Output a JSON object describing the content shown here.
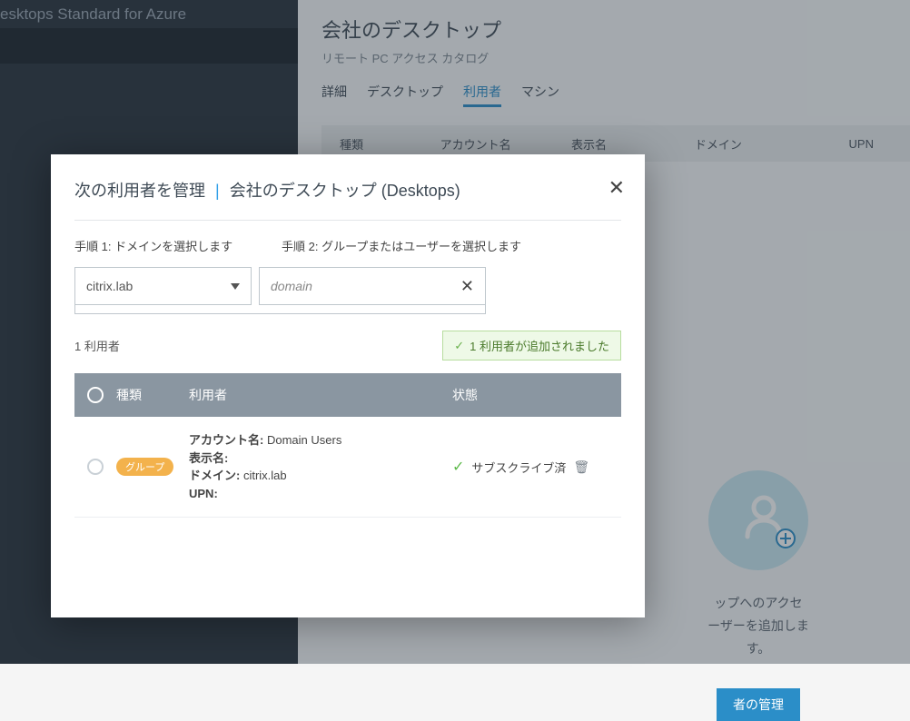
{
  "background": {
    "product_name": "esktops Standard for Azure",
    "page_title": "会社のデスクトップ",
    "page_subtitle": "リモート PC アクセス カタログ",
    "tabs": {
      "details": "詳細",
      "desktops": "デスクトップ",
      "subscribers": "利用者",
      "machines": "マシン"
    },
    "table_headers": {
      "kind": "種類",
      "account": "アカウント名",
      "display": "表示名",
      "domain": "ドメイン",
      "upn": "UPN"
    },
    "empty_text_l1": "ップへのアクセ",
    "empty_text_l2": "ーザーを追加しま",
    "empty_text_l3": "す。",
    "manage_button": "者の管理"
  },
  "modal": {
    "title_prefix": "次の利用者を管理",
    "title_catalog": "会社のデスクトップ (Desktops)",
    "step1_label": "手順 1: ドメインを選択します",
    "step2_label": "手順 2: グループまたはユーザーを選択します",
    "domain_value": "citrix.lab",
    "search_value": "domain",
    "count_label": "1 利用者",
    "added_banner": "1 利用者が追加されました",
    "cols": {
      "kind": "種類",
      "subscriber": "利用者",
      "status": "状態"
    },
    "row": {
      "group_pill": "グループ",
      "account_label": "アカウント名:",
      "account_value": "Domain Users",
      "display_label": "表示名:",
      "display_value": "",
      "domain_label": "ドメイン:",
      "domain_value": "citrix.lab",
      "upn_label": "UPN:",
      "upn_value": "",
      "status_text": "サブスクライブ済"
    }
  }
}
